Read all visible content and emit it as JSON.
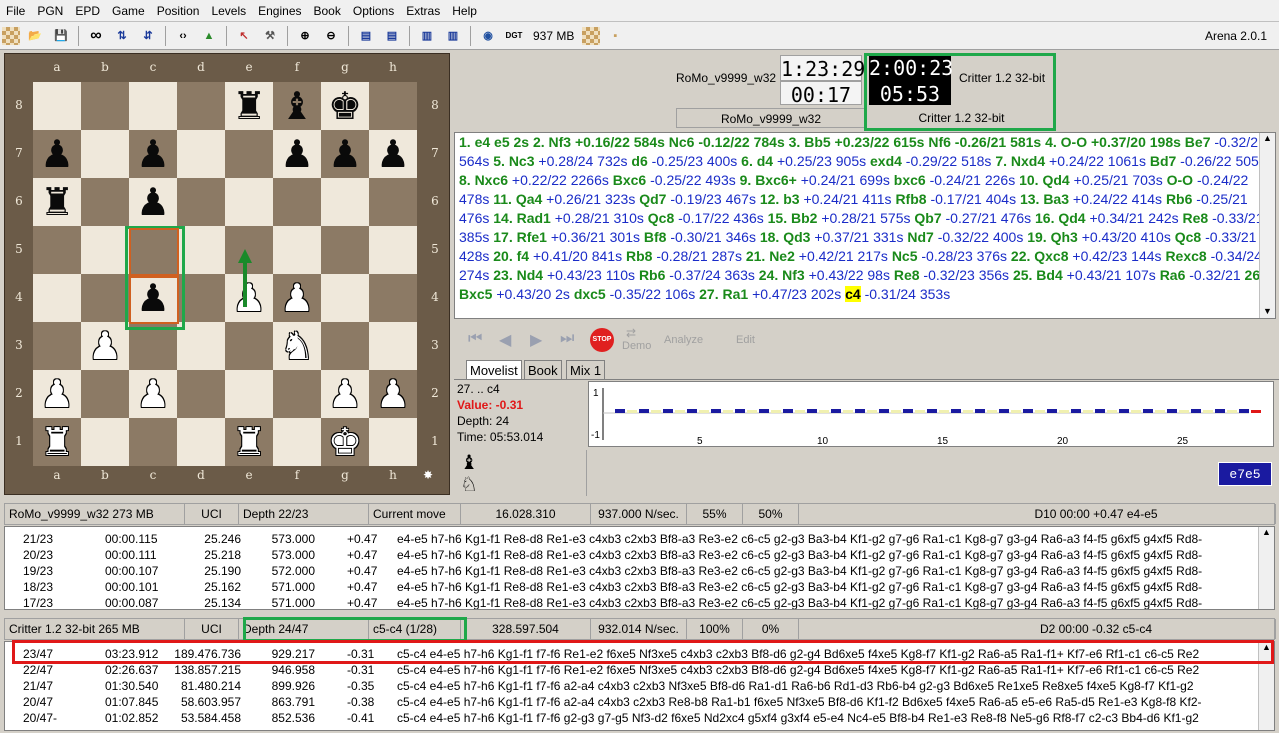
{
  "menu": [
    "File",
    "PGN",
    "EPD",
    "Game",
    "Position",
    "Levels",
    "Engines",
    "Book",
    "Options",
    "Extras",
    "Help"
  ],
  "toolbar": {
    "memory": "937 MB",
    "app_title": "Arena 2.0.1"
  },
  "board": {
    "files": [
      "a",
      "b",
      "c",
      "d",
      "e",
      "f",
      "g",
      "h"
    ],
    "ranks": [
      "8",
      "7",
      "6",
      "5",
      "4",
      "3",
      "2",
      "1"
    ],
    "position": [
      [
        "",
        "",
        "",
        "",
        "bR",
        "bB",
        "bK",
        ""
      ],
      [
        "bP",
        "",
        "bP",
        "",
        "",
        "bP",
        "bP",
        "bP"
      ],
      [
        "bR",
        "",
        "bP",
        "",
        "",
        "",
        "",
        ""
      ],
      [
        "",
        "",
        "",
        "",
        "",
        "",
        "",
        ""
      ],
      [
        "",
        "",
        "bP",
        "",
        "wP",
        "wP",
        "",
        ""
      ],
      [
        "",
        "wP",
        "",
        "",
        "",
        "wN",
        "",
        ""
      ],
      [
        "wP",
        "",
        "wP",
        "",
        "",
        "",
        "wP",
        "wP"
      ],
      [
        "wR",
        "",
        "",
        "",
        "wR",
        "",
        "wK",
        ""
      ]
    ]
  },
  "clocks": {
    "white_name": "RoMo_v9999_w32",
    "white_time": "1:23:29",
    "white_move_time": "00:17",
    "black_name": "Critter 1.2 32-bit",
    "black_time": "2:00:23",
    "black_move_time": "05:53",
    "white_label": "RoMo_v9999_w32",
    "black_label": "Critter 1.2 32-bit"
  },
  "movelist": [
    {
      "t": "n",
      "v": "1. e4 e5 2s 2. Nf3 +0.16/22 584s Nc6 -0.12/22 784s 3. Bb5 +0.23/22 615s Nf6 -0.26/21 581s 4. O-O +0.37/20 198s Be7 "
    },
    {
      "t": "p",
      "v": "-0.32/21 564s "
    },
    {
      "t": "n",
      "v": "5. Nc3"
    },
    {
      "t": "p",
      "v": " +0.28/24 732s "
    },
    {
      "t": "n",
      "v": "d6"
    },
    {
      "t": "p",
      "v": " -0.25/23 400s "
    },
    {
      "t": "n",
      "v": "6. d4"
    },
    {
      "t": "p",
      "v": " +0.25/23 905s "
    },
    {
      "t": "n",
      "v": "exd4"
    },
    {
      "t": "p",
      "v": " -0.29/22 518s "
    },
    {
      "t": "n",
      "v": "7. Nxd4"
    },
    {
      "t": "p",
      "v": " +0.24/22 1061s "
    },
    {
      "t": "n",
      "v": "Bd7"
    },
    {
      "t": "p",
      "v": " -0.26/22 505s "
    },
    {
      "t": "n",
      "v": "8. Nxc6"
    },
    {
      "t": "p",
      "v": " +0.22/22 2266s "
    },
    {
      "t": "n",
      "v": "Bxc6"
    },
    {
      "t": "p",
      "v": " -0.25/22 493s "
    },
    {
      "t": "n",
      "v": "9. Bxc6+"
    },
    {
      "t": "p",
      "v": " +0.24/21 699s "
    },
    {
      "t": "n",
      "v": "bxc6"
    },
    {
      "t": "p",
      "v": " -0.24/21 226s "
    },
    {
      "t": "n",
      "v": "10. Qd4"
    },
    {
      "t": "p",
      "v": " +0.25/21 703s "
    },
    {
      "t": "n",
      "v": "O-O"
    },
    {
      "t": "p",
      "v": " -0.24/22 478s "
    },
    {
      "t": "n",
      "v": "11. Qa4"
    },
    {
      "t": "p",
      "v": " +0.26/21 323s "
    },
    {
      "t": "n",
      "v": "Qd7"
    },
    {
      "t": "p",
      "v": " -0.19/23 467s "
    },
    {
      "t": "n",
      "v": "12. b3"
    },
    {
      "t": "p",
      "v": " +0.24/21 411s "
    },
    {
      "t": "n",
      "v": "Rfb8"
    },
    {
      "t": "p",
      "v": " -0.17/21 404s "
    },
    {
      "t": "n",
      "v": "13. Ba3"
    },
    {
      "t": "p",
      "v": " +0.24/22 414s "
    },
    {
      "t": "n",
      "v": "Rb6"
    },
    {
      "t": "p",
      "v": " -0.25/21 476s "
    },
    {
      "t": "n",
      "v": "14. Rad1"
    },
    {
      "t": "p",
      "v": " +0.28/21 310s "
    },
    {
      "t": "n",
      "v": "Qc8"
    },
    {
      "t": "p",
      "v": " -0.17/22 436s "
    },
    {
      "t": "n",
      "v": "15. Bb2"
    },
    {
      "t": "p",
      "v": " +0.28/21 575s "
    },
    {
      "t": "n",
      "v": "Qb7"
    },
    {
      "t": "p",
      "v": " -0.27/21 476s "
    },
    {
      "t": "n",
      "v": "16. Qd4"
    },
    {
      "t": "p",
      "v": " +0.34/21 242s "
    },
    {
      "t": "n",
      "v": "Re8"
    },
    {
      "t": "p",
      "v": " -0.33/21 385s "
    },
    {
      "t": "n",
      "v": "17. Rfe1"
    },
    {
      "t": "p",
      "v": " +0.36/21 301s "
    },
    {
      "t": "n",
      "v": "Bf8"
    },
    {
      "t": "p",
      "v": " -0.30/21 346s "
    },
    {
      "t": "n",
      "v": "18. Qd3"
    },
    {
      "t": "p",
      "v": " +0.37/21 "
    },
    {
      "t": "p",
      "v": "331s "
    },
    {
      "t": "n",
      "v": "Nd7"
    },
    {
      "t": "p",
      "v": " -0.32/22 400s "
    },
    {
      "t": "n",
      "v": "19. Qh3"
    },
    {
      "t": "p",
      "v": " +0.43/20 410s "
    },
    {
      "t": "n",
      "v": "Qc8"
    },
    {
      "t": "p",
      "v": " -0.33/21 428s "
    },
    {
      "t": "n",
      "v": "20. f4"
    },
    {
      "t": "p",
      "v": " +0.41/20 841s "
    },
    {
      "t": "n",
      "v": "Rb8"
    },
    {
      "t": "p",
      "v": " -0.28/21 287s "
    },
    {
      "t": "n",
      "v": "21. Ne2"
    },
    {
      "t": "p",
      "v": " +0.42/21 217s "
    },
    {
      "t": "n",
      "v": "Nc5"
    },
    {
      "t": "p",
      "v": " -0.28/23 376s "
    },
    {
      "t": "n",
      "v": "22. Qxc8"
    },
    {
      "t": "p",
      "v": " +0.42/23 144s "
    },
    {
      "t": "n",
      "v": "Rexc8"
    },
    {
      "t": "p",
      "v": " -0.34/24 274s "
    },
    {
      "t": "n",
      "v": "23. Nd4"
    },
    {
      "t": "p",
      "v": " +0.43/23 110s "
    },
    {
      "t": "n",
      "v": "Rb6"
    },
    {
      "t": "p",
      "v": "  -0.37/24 "
    },
    {
      "t": "p",
      "v": "363s "
    },
    {
      "t": "n",
      "v": "24. Nf3"
    },
    {
      "t": "p",
      "v": " +0.43/22 98s "
    },
    {
      "t": "n",
      "v": "Re8"
    },
    {
      "t": "p",
      "v": " -0.32/23 356s "
    },
    {
      "t": "n",
      "v": "25. Bd4"
    },
    {
      "t": "p",
      "v": " +0.43/21 107s "
    },
    {
      "t": "n",
      "v": "Ra6"
    },
    {
      "t": "p",
      "v": " -0.32/21 "
    },
    {
      "t": "n",
      "v": "26. Bxc5"
    },
    {
      "t": "p",
      "v": " +0.43/20 2s "
    },
    {
      "t": "n",
      "v": "dxc5"
    },
    {
      "t": "p",
      "v": "  -0.35/22 "
    },
    {
      "t": "p",
      "v": "106s "
    },
    {
      "t": "n",
      "v": "27. Ra1"
    },
    {
      "t": "p",
      "v": " +0.47/23 202s "
    },
    {
      "t": "h",
      "v": "c4"
    },
    {
      "t": "p",
      "v": " -0.31/24 353s"
    }
  ],
  "nav": {
    "stop": "STOP",
    "demo": "Demo",
    "analyze": "Analyze",
    "edit": "Edit"
  },
  "tabs": [
    "Movelist",
    "Book",
    "Mix 1"
  ],
  "info": {
    "move": "27. .. c4",
    "value": "Value: -0.31",
    "depth": "Depth: 24",
    "time": "Time: 05:53.014",
    "last_move": "e7e5"
  },
  "graph": {
    "y_top": "1",
    "y_bottom": "-1",
    "x_ticks": [
      "5",
      "10",
      "15",
      "20",
      "25"
    ]
  },
  "engine1": {
    "name": "RoMo_v9999_w32  273 MB",
    "protocol": "UCI",
    "depth": "Depth 22/23",
    "current": "Current move",
    "nodes": "16.028.310",
    "nps": "937.000 N/sec.",
    "pct1": "55%",
    "pct2": "50%",
    "status": "D10  00:00  +0.47   e4-e5",
    "rows": [
      [
        "21/23",
        "00:00.115",
        "25.246",
        "573.000",
        "+0.47",
        "e4-e5 h7-h6 Kg1-f1 Re8-d8 Re1-e3 c4xb3 c2xb3 Bf8-a3 Re3-e2 c6-c5 g2-g3 Ba3-b4 Kf1-g2 g7-g6 Ra1-c1 Kg8-g7 g3-g4 Ra6-a3 f4-f5 g6xf5 g4xf5 Rd8-"
      ],
      [
        "20/23",
        "00:00.111",
        "25.218",
        "573.000",
        "+0.47",
        "e4-e5 h7-h6 Kg1-f1 Re8-d8 Re1-e3 c4xb3 c2xb3 Bf8-a3 Re3-e2 c6-c5 g2-g3 Ba3-b4 Kf1-g2 g7-g6 Ra1-c1 Kg8-g7 g3-g4 Ra6-a3 f4-f5 g6xf5 g4xf5 Rd8-"
      ],
      [
        "19/23",
        "00:00.107",
        "25.190",
        "572.000",
        "+0.47",
        "e4-e5 h7-h6 Kg1-f1 Re8-d8 Re1-e3 c4xb3 c2xb3 Bf8-a3 Re3-e2 c6-c5 g2-g3 Ba3-b4 Kf1-g2 g7-g6 Ra1-c1 Kg8-g7 g3-g4 Ra6-a3 f4-f5 g6xf5 g4xf5 Rd8-"
      ],
      [
        "18/23",
        "00:00.101",
        "25.162",
        "571.000",
        "+0.47",
        "e4-e5 h7-h6 Kg1-f1 Re8-d8 Re1-e3 c4xb3 c2xb3 Bf8-a3 Re3-e2 c6-c5 g2-g3 Ba3-b4 Kf1-g2 g7-g6 Ra1-c1 Kg8-g7 g3-g4 Ra6-a3 f4-f5 g6xf5 g4xf5 Rd8-"
      ],
      [
        "17/23",
        "00:00.087",
        "25.134",
        "571.000",
        "+0.47",
        "e4-e5 h7-h6 Kg1-f1 Re8-d8 Re1-e3 c4xb3 c2xb3 Bf8-a3 Re3-e2 c6-c5 g2-g3 Ba3-b4 Kf1-g2 g7-g6 Ra1-c1 Kg8-g7 g3-g4 Ra6-a3 f4-f5 g6xf5 g4xf5 Rd8-"
      ]
    ]
  },
  "engine2": {
    "name": "Critter 1.2 32-bit  265 MB",
    "protocol": "UCI",
    "depth": "Depth 24/47",
    "current": "c5-c4 (1/28)",
    "nodes": "328.597.504",
    "nps": "932.014 N/sec.",
    "pct1": "100%",
    "pct2": "0%",
    "status": "D2  00:00  -0.32   c5-c4",
    "rows": [
      [
        "23/47",
        "03:23.912",
        "189.476.736",
        "929.217",
        "-0.31",
        "c5-c4 e4-e5 h7-h6 Kg1-f1 f7-f6 Re1-e2 f6xe5 Nf3xe5 c4xb3 c2xb3 Bf8-d6 g2-g4 Bd6xe5 f4xe5 Kg8-f7 Kf1-g2 Ra6-a5 Ra1-f1+ Kf7-e6 Rf1-c1 c6-c5 Re2"
      ],
      [
        "22/47",
        "02:26.637",
        "138.857.215",
        "946.958",
        "-0.31",
        "c5-c4 e4-e5 h7-h6 Kg1-f1 f7-f6 Re1-e2 f6xe5 Nf3xe5 c4xb3 c2xb3 Bf8-d6 g2-g4 Bd6xe5 f4xe5 Kg8-f7 Kf1-g2 Ra6-a5 Ra1-f1+ Kf7-e6 Rf1-c1 c6-c5 Re2"
      ],
      [
        "21/47",
        "01:30.540",
        "81.480.214",
        "899.926",
        "-0.35",
        "c5-c4 e4-e5 h7-h6 Kg1-f1 f7-f6 a2-a4 c4xb3 c2xb3 Nf3xe5 Bf8-d6 Ra1-d1 Ra6-b6 Rd1-d3 Rb6-b4 g2-g3 Bd6xe5 Re1xe5 Re8xe5 f4xe5 Kg8-f7 Kf1-g2"
      ],
      [
        "20/47",
        "01:07.845",
        "58.603.957",
        "863.791",
        "-0.38",
        "c5-c4 e4-e5 h7-h6 Kg1-f1 f7-f6 a2-a4 c4xb3 c2xb3 Re8-b8 Ra1-b1 f6xe5 Nf3xe5 Bf8-d6 Kf1-f2 Bd6xe5 f4xe5 Ra6-a5 e5-e6 Ra5-d5 Re1-e3 Kg8-f8 Kf2-"
      ],
      [
        "20/47-",
        "01:02.852",
        "53.584.458",
        "852.536",
        "-0.41",
        "c5-c4 e4-e5 h7-h6 Kg1-f1 f7-f6 g2-g3 g7-g5 Nf3-d2 f6xe5 Nd2xc4 g5xf4 g3xf4 e5-e4 Nc4-e5 Bf8-b4 Re1-e3 Re8-f8 Ne5-g6 Rf8-f7 c2-c3 Bb4-d6 Kf1-g2"
      ]
    ]
  }
}
